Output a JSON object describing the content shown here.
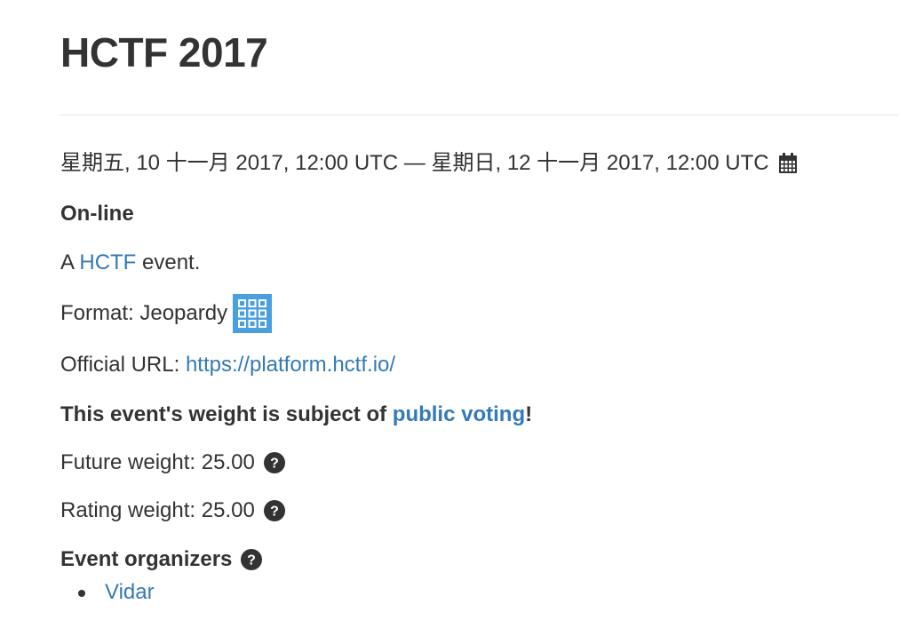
{
  "page": {
    "title": "HCTF 2017"
  },
  "date_line": {
    "text": "星期五, 10 十一月 2017, 12:00 UTC — 星期日, 12 十一月 2017, 12:00 UTC",
    "icon": "calendar-icon"
  },
  "location": "On-line",
  "event_by": {
    "prefix": "A ",
    "link_text": "HCTF",
    "suffix": " event."
  },
  "format": {
    "label": "Format: Jeopardy",
    "icon": "jeopardy-grid-icon",
    "icon_color": "#4a9fe0"
  },
  "official_url": {
    "label": "Official URL: ",
    "link_text": "https://platform.hctf.io/"
  },
  "voting": {
    "prefix": "This event's weight is subject of ",
    "link_text": "public voting",
    "suffix": "!"
  },
  "future_weight": {
    "text": "Future weight: 25.00",
    "icon": "question-circle-icon"
  },
  "rating_weight": {
    "text": "Rating weight: 25.00",
    "icon": "question-circle-icon"
  },
  "organizers": {
    "heading": "Event organizers",
    "icon": "question-circle-icon",
    "items": [
      "Vidar"
    ]
  },
  "colors": {
    "text": "#333333",
    "link": "#337ab7",
    "divider": "#e5e5e5"
  }
}
